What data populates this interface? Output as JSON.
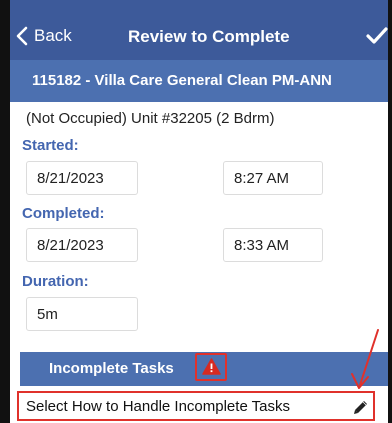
{
  "nav": {
    "back_label": "Back",
    "title": "Review to Complete"
  },
  "work_order": {
    "title": "115182 - Villa Care General Clean PM-ANN"
  },
  "unit": {
    "description": "(Not Occupied)  Unit #32205 (2 Bdrm)"
  },
  "started": {
    "label": "Started:",
    "date": "8/21/2023",
    "time": "8:27 AM"
  },
  "completed": {
    "label": "Completed:",
    "date": "8/21/2023",
    "time": "8:33 AM"
  },
  "duration": {
    "label": "Duration:",
    "value": "5m"
  },
  "incomplete_tasks": {
    "label": "Incomplete Tasks",
    "handle_label": "Select How to Handle Incomplete Tasks"
  },
  "icons": {
    "back": "chevron-left-icon",
    "confirm": "checkmark-icon",
    "alert": "warning-triangle-icon",
    "edit": "pencil-icon"
  },
  "colors": {
    "nav_bar": "#3d5a9a",
    "section_bar": "#4c70b0",
    "section_label": "#4466b0",
    "annotation_red": "#e0312b"
  }
}
